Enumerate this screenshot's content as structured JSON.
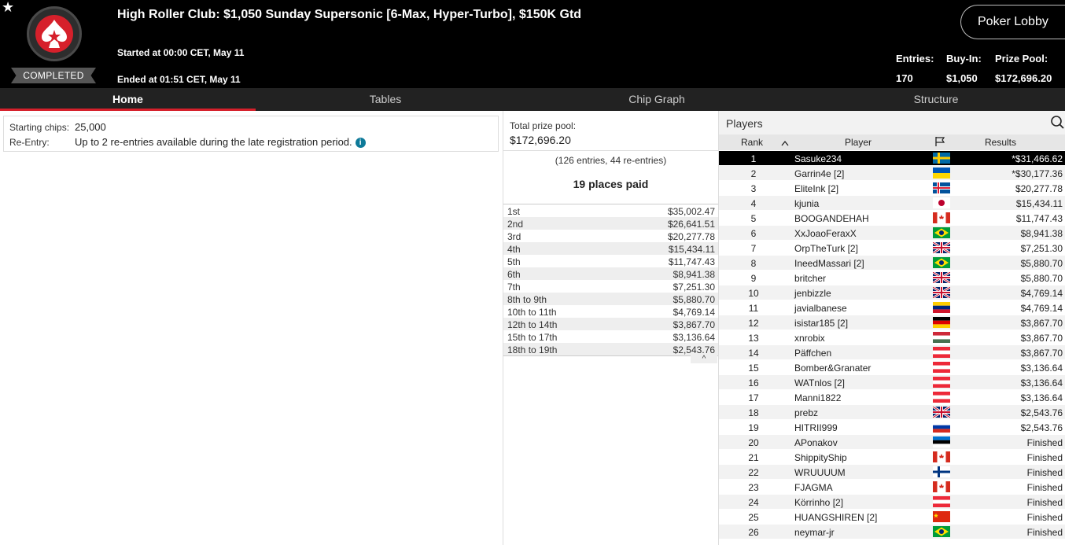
{
  "header": {
    "title": "High Roller Club: $1,050 Sunday Supersonic [6-Max, Hyper-Turbo], $150K Gtd",
    "status_badge": "COMPLETED",
    "started": "Started at 00:00 CET, May 11",
    "ended": "Ended at 01:51 CET, May 11",
    "lobby_button": "Poker Lobby",
    "stats": [
      {
        "label": "Entries:",
        "value": "170"
      },
      {
        "label": "Buy-In:",
        "value": "$1,050"
      },
      {
        "label": "Prize Pool:",
        "value": "$172,696.20"
      }
    ]
  },
  "tabs": [
    {
      "label": "Home",
      "active": true
    },
    {
      "label": "Tables"
    },
    {
      "label": "Chip Graph"
    },
    {
      "label": "Structure"
    }
  ],
  "info": {
    "starting_chips_label": "Starting chips:",
    "starting_chips_value": "25,000",
    "reentry_label": "Re-Entry:",
    "reentry_value": "Up to 2 re-entries available during the late registration period."
  },
  "prize": {
    "label": "Total prize pool:",
    "total": "$172,696.20",
    "entries_note": "(126 entries, 44 re-entries)",
    "places_paid": "19 places paid",
    "payouts": [
      {
        "place": "1st",
        "amount": "$35,002.47"
      },
      {
        "place": "2nd",
        "amount": "$26,641.51"
      },
      {
        "place": "3rd",
        "amount": "$20,277.78"
      },
      {
        "place": "4th",
        "amount": "$15,434.11"
      },
      {
        "place": "5th",
        "amount": "$11,747.43"
      },
      {
        "place": "6th",
        "amount": "$8,941.38"
      },
      {
        "place": "7th",
        "amount": "$7,251.30"
      },
      {
        "place": "8th to 9th",
        "amount": "$5,880.70"
      },
      {
        "place": "10th to 11th",
        "amount": "$4,769.14"
      },
      {
        "place": "12th to 14th",
        "amount": "$3,867.70"
      },
      {
        "place": "15th to 17th",
        "amount": "$3,136.64"
      },
      {
        "place": "18th to 19th",
        "amount": "$2,543.76"
      }
    ]
  },
  "players": {
    "title": "Players",
    "columns": {
      "rank": "Rank",
      "player": "Player",
      "results": "Results"
    },
    "rows": [
      {
        "rank": "1",
        "name": "Sasuke234",
        "flag": "se",
        "result": "*$31,466.62"
      },
      {
        "rank": "2",
        "name": "Garrin4e [2]",
        "flag": "ua",
        "result": "*$30,177.36"
      },
      {
        "rank": "3",
        "name": "EliteInk [2]",
        "flag": "is",
        "result": "$20,277.78"
      },
      {
        "rank": "4",
        "name": "kjunia",
        "flag": "jp",
        "result": "$15,434.11"
      },
      {
        "rank": "5",
        "name": "BOOGANDEHAH",
        "flag": "ca",
        "result": "$11,747.43"
      },
      {
        "rank": "6",
        "name": "XxJoaoFeraxX",
        "flag": "br",
        "result": "$8,941.38"
      },
      {
        "rank": "7",
        "name": "OrpTheTurk [2]",
        "flag": "gb",
        "result": "$7,251.30"
      },
      {
        "rank": "8",
        "name": "IneedMassari [2]",
        "flag": "br",
        "result": "$5,880.70"
      },
      {
        "rank": "9",
        "name": "britcher",
        "flag": "gb",
        "result": "$5,880.70"
      },
      {
        "rank": "10",
        "name": "jenbizzle",
        "flag": "gb",
        "result": "$4,769.14"
      },
      {
        "rank": "11",
        "name": "javialbanese",
        "flag": "ve",
        "result": "$4,769.14"
      },
      {
        "rank": "12",
        "name": "isistar185 [2]",
        "flag": "de",
        "result": "$3,867.70"
      },
      {
        "rank": "13",
        "name": "xnrobix",
        "flag": "hu",
        "result": "$3,867.70"
      },
      {
        "rank": "14",
        "name": "Päffchen",
        "flag": "at",
        "result": "$3,867.70"
      },
      {
        "rank": "15",
        "name": "Bomber&Granater",
        "flag": "at",
        "result": "$3,136.64"
      },
      {
        "rank": "16",
        "name": "WATnlos [2]",
        "flag": "at",
        "result": "$3,136.64"
      },
      {
        "rank": "17",
        "name": "Manni1822",
        "flag": "at",
        "result": "$3,136.64"
      },
      {
        "rank": "18",
        "name": "prebz",
        "flag": "gb",
        "result": "$2,543.76"
      },
      {
        "rank": "19",
        "name": "HITRII999",
        "flag": "ru",
        "result": "$2,543.76"
      },
      {
        "rank": "20",
        "name": "APonakov",
        "flag": "ee",
        "result": "Finished"
      },
      {
        "rank": "21",
        "name": "ShippityShip",
        "flag": "ca",
        "result": "Finished"
      },
      {
        "rank": "22",
        "name": "WRUUUUM",
        "flag": "fi",
        "result": "Finished"
      },
      {
        "rank": "23",
        "name": "FJAGMA",
        "flag": "ca",
        "result": "Finished"
      },
      {
        "rank": "24",
        "name": "Körrinho [2]",
        "flag": "at",
        "result": "Finished"
      },
      {
        "rank": "25",
        "name": "HUANGSHIREN [2]",
        "flag": "cn",
        "result": "Finished"
      },
      {
        "rank": "26",
        "name": "neymar-jr",
        "flag": "br",
        "result": "Finished"
      }
    ]
  }
}
